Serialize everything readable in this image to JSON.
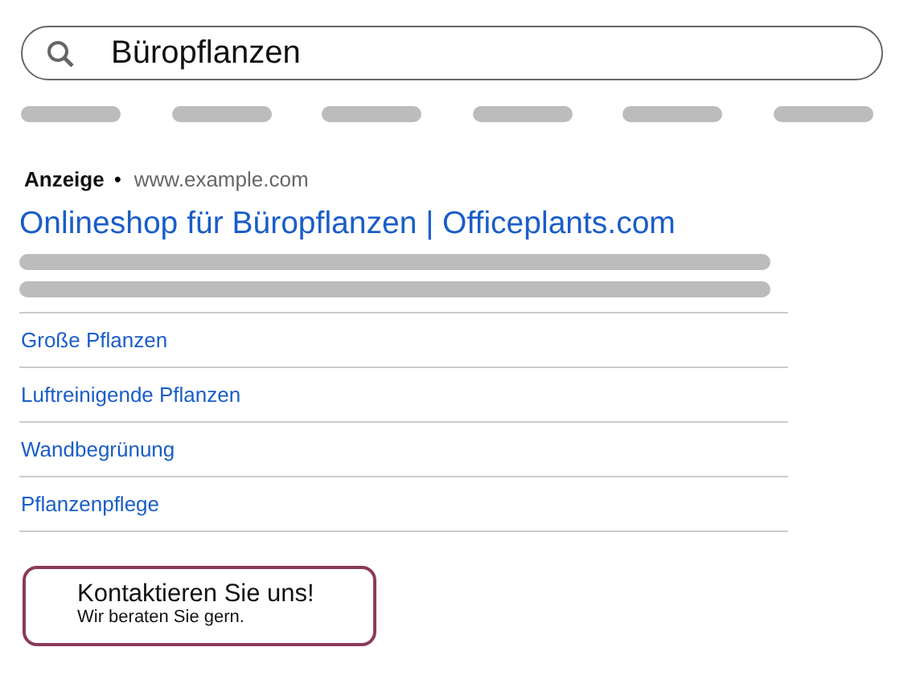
{
  "search": {
    "value": "Büropflanzen"
  },
  "ad": {
    "label": "Anzeige",
    "separator": "•",
    "url": "www.example.com",
    "title": "Onlineshop für Büropflanzen | Officeplants.com",
    "sitelinks": [
      "Große Pflanzen",
      "Luftreinigende Pflanzen",
      "Wandbegrünung",
      "Pflanzenpflege"
    ]
  },
  "contact_button": {
    "title": "Kontaktieren Sie uns!",
    "subtitle": "Wir beraten Sie gern."
  }
}
